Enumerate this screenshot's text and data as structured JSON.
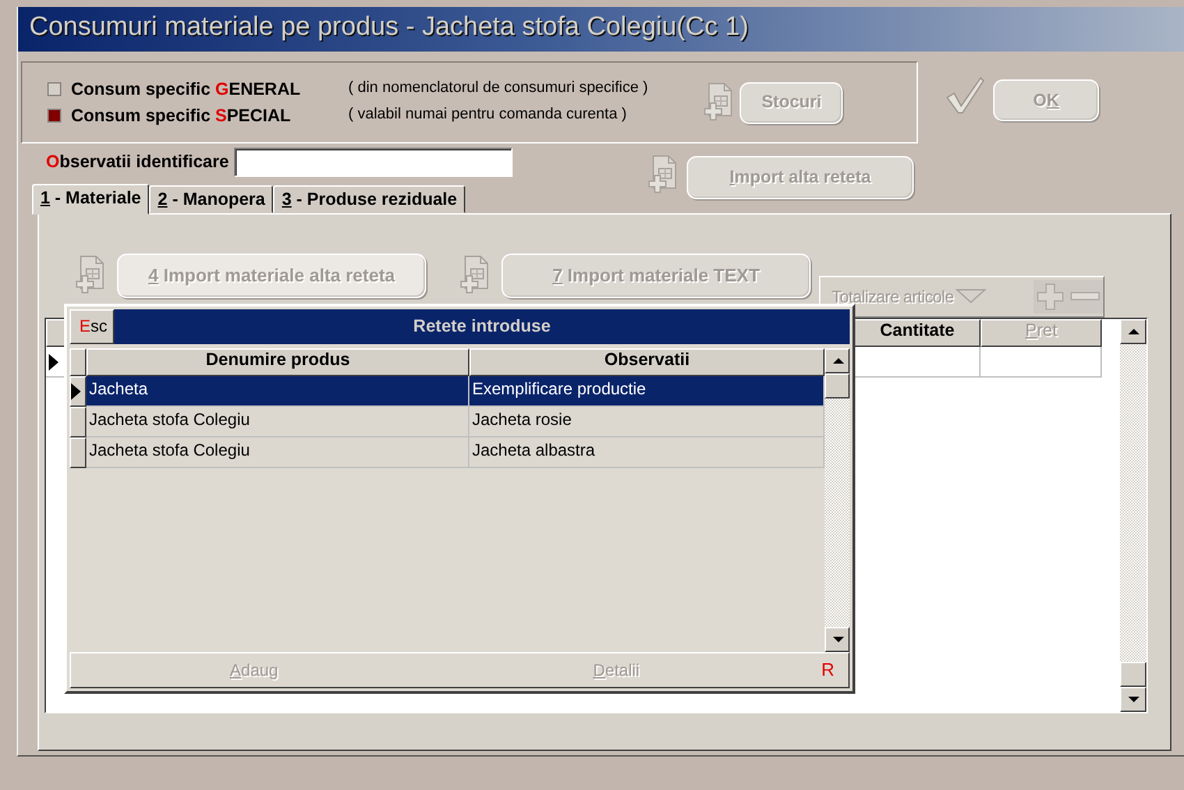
{
  "window": {
    "title": "Consumuri materiale pe produs - Jacheta stofa Colegiu(Cc 1)"
  },
  "legend": [
    {
      "color": "#d4d0c8",
      "label": [
        {
          "text": "Consum specific ",
          "kind": "plain"
        },
        {
          "text": "G",
          "kind": "accent"
        },
        {
          "text": "ENERAL",
          "kind": "plain"
        }
      ],
      "note": "( din nomenclatorul de consumuri specifice )"
    },
    {
      "color": "#800000",
      "label": [
        {
          "text": "Consum specific ",
          "kind": "plain"
        },
        {
          "text": "S",
          "kind": "accent"
        },
        {
          "text": "PECIAL",
          "kind": "plain"
        }
      ],
      "note": "( valabil numai pentru comanda curenta )"
    }
  ],
  "stocuri_button": {
    "label": "Stocuri",
    "disabled": true
  },
  "ok_button": {
    "label": [
      {
        "text": "O",
        "kind": "plain"
      },
      {
        "text": "K",
        "kind": "hotkey"
      }
    ],
    "disabled": true
  },
  "observatii": {
    "label": [
      {
        "text": "O",
        "kind": "accent"
      },
      {
        "text": "bservatii identificare",
        "kind": "plain"
      }
    ]
  },
  "import_button": {
    "label": [
      {
        "text": "I",
        "kind": "hotkey"
      },
      {
        "text": "mport alta reteta",
        "kind": "plain"
      }
    ],
    "disabled": true
  },
  "tabs": [
    {
      "label": [
        {
          "text": "1",
          "kind": "hotkey"
        },
        {
          "text": " - Materiale",
          "kind": "plain"
        }
      ],
      "selected": true
    },
    {
      "label": [
        {
          "text": "2",
          "kind": "hotkey"
        },
        {
          "text": " - Manopera",
          "kind": "plain"
        }
      ],
      "selected": false
    },
    {
      "label": [
        {
          "text": "3",
          "kind": "hotkey"
        },
        {
          "text": " - Produse reziduale",
          "kind": "plain"
        }
      ],
      "selected": false
    }
  ],
  "import_buttons": [
    {
      "label": [
        {
          "text": "4",
          "kind": "hotkey"
        },
        {
          "text": " Import materiale alta reteta",
          "kind": "plain"
        }
      ],
      "disabled": true
    },
    {
      "label": [
        {
          "text": "7",
          "kind": "hotkey"
        },
        {
          "text": " Import materiale TEXT",
          "kind": "plain"
        }
      ],
      "disabled": true
    }
  ],
  "totals": {
    "label": "Totalizare articole",
    "disabled": true
  },
  "materials_grid": {
    "columns": [
      {
        "label": [
          {
            "text": "Cantitate",
            "kind": "plain"
          }
        ],
        "disabled": false
      },
      {
        "label": [
          {
            "text": "P",
            "kind": "hotkey"
          },
          {
            "text": "ret",
            "kind": "plain"
          }
        ],
        "disabled": true
      }
    ],
    "rows": [
      {
        "selected": true
      }
    ]
  },
  "recipes_popup": {
    "esc": [
      {
        "text": "E",
        "kind": "accent"
      },
      {
        "text": "sc",
        "kind": "plain"
      }
    ],
    "title": "Retete introduse",
    "columns": [
      "Denumire produs",
      "Observatii"
    ],
    "rows": [
      {
        "cells": [
          "Jacheta",
          "Exemplificare productie"
        ],
        "selected": true
      },
      {
        "cells": [
          "Jacheta stofa Colegiu",
          "Jacheta rosie"
        ],
        "selected": false
      },
      {
        "cells": [
          "Jacheta stofa Colegiu",
          "Jacheta albastra"
        ],
        "selected": false
      }
    ],
    "footer": [
      {
        "label": [
          {
            "text": "A",
            "kind": "hotkey"
          },
          {
            "text": "daug",
            "kind": "plain"
          }
        ],
        "disabled": true
      },
      {
        "label": [
          {
            "text": "D",
            "kind": "hotkey"
          },
          {
            "text": "etalii",
            "kind": "plain"
          }
        ],
        "disabled": true
      }
    ],
    "footer_mark": "R"
  }
}
